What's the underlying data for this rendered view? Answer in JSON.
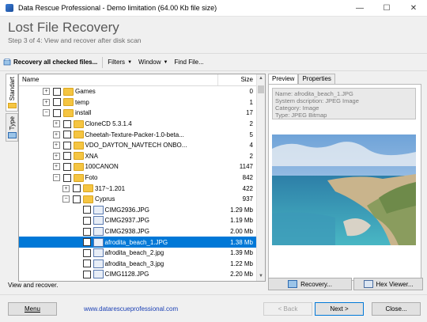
{
  "window": {
    "title": "Data Rescue Professional - Demo limitation (64.00 Kb file size)",
    "controls": {
      "minimize": "—",
      "maximize": "☐",
      "close": "✕"
    }
  },
  "header": {
    "title": "Lost File Recovery",
    "subtitle": "Step 3 of 4: View and recover after disk scan"
  },
  "toolbar": {
    "recovery_checked": "Recovery all checked files...",
    "filters": "Filters",
    "window": "Window",
    "find_file": "Find File..."
  },
  "side_tabs": {
    "standart": "Standart",
    "type": "Type"
  },
  "tree": {
    "columns": {
      "name": "Name",
      "size": "Size"
    },
    "rows": [
      {
        "name": "Games",
        "size": "0",
        "level": 2,
        "kind": "folder",
        "expander": "+"
      },
      {
        "name": "temp",
        "size": "1",
        "level": 2,
        "kind": "folder",
        "expander": "+"
      },
      {
        "name": "install",
        "size": "17",
        "level": 2,
        "kind": "folder",
        "expander": "−"
      },
      {
        "name": "CloneCD 5.3.1.4",
        "size": "2",
        "level": 3,
        "kind": "folder",
        "expander": "+"
      },
      {
        "name": "Cheetah-Texture-Packer-1.0-beta...",
        "size": "5",
        "level": 3,
        "kind": "folder",
        "expander": "+"
      },
      {
        "name": "VDO_DAYTON_NAVTECH ONBO...",
        "size": "4",
        "level": 3,
        "kind": "folder",
        "expander": "+"
      },
      {
        "name": "XNA",
        "size": "2",
        "level": 3,
        "kind": "folder",
        "expander": "+"
      },
      {
        "name": "100CANON",
        "size": "1147",
        "level": 3,
        "kind": "folder",
        "expander": "+"
      },
      {
        "name": "Foto",
        "size": "842",
        "level": 3,
        "kind": "folder",
        "expander": "−"
      },
      {
        "name": "317~1.201",
        "size": "422",
        "level": 4,
        "kind": "folder",
        "expander": "+"
      },
      {
        "name": "Cyprus",
        "size": "937",
        "level": 4,
        "kind": "folder",
        "expander": "−"
      },
      {
        "name": "CIMG2936.JPG",
        "size": "1.29 Mb",
        "level": 5,
        "kind": "file"
      },
      {
        "name": "CIMG2937.JPG",
        "size": "1.19 Mb",
        "level": 5,
        "kind": "file"
      },
      {
        "name": "CIMG2938.JPG",
        "size": "2.00 Mb",
        "level": 5,
        "kind": "file"
      },
      {
        "name": "afrodita_beach_1.JPG",
        "size": "1.38 Mb",
        "level": 5,
        "kind": "file",
        "selected": true
      },
      {
        "name": "afrodita_beach_2.jpg",
        "size": "1.39 Mb",
        "level": 5,
        "kind": "file"
      },
      {
        "name": "afrodita_beach_3.jpg",
        "size": "1.22 Mb",
        "level": 5,
        "kind": "file"
      },
      {
        "name": "CIMG1128.JPG",
        "size": "2.20 Mb",
        "level": 5,
        "kind": "file"
      }
    ]
  },
  "preview": {
    "tabs": {
      "preview": "Preview",
      "properties": "Properties"
    },
    "info": {
      "name": "Name: afrodita_beach_1.JPG",
      "system": "System dscription: JPEG Image",
      "category": "Category: Image",
      "type": "Type: JPEG Bitmap"
    },
    "recovery_button": "Recovery...",
    "hex_button": "Hex Viewer..."
  },
  "status": "View and recover.",
  "footer": {
    "menu": "Menu",
    "site": "www.datarescueprofessional.com",
    "back": "< Back",
    "next": "Next >",
    "close": "Close..."
  },
  "colors": {
    "selection": "#0078d7",
    "folder": "#f5c542",
    "link": "#1a3fb4"
  }
}
